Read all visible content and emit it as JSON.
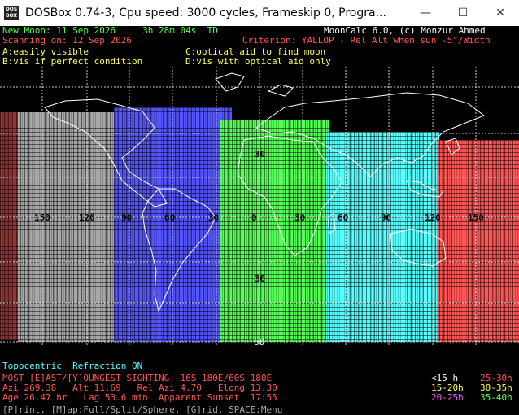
{
  "window": {
    "title": "DOSBox 0.74-3, Cpu speed:     3000 cycles, Frameskip  0, Progra...",
    "icon_label": "DOS BOX",
    "minimize": "—",
    "maximize": "☐",
    "close": "✕"
  },
  "header": {
    "new_moon": "New Moon: 11 Sep 2026     3h 28m 04s  TD",
    "program": "MoonCalc 6.0, (c) Monzur Ahmed",
    "scanning": "Scanning on: 12 Sep 2026",
    "criterion": "Criterion: YALLOP - Rel Alt when sun -5°/Width",
    "legend_a": "A:easily visible",
    "legend_c": "C:optical aid to find moon",
    "legend_b": "B:vis if perfect condition",
    "legend_d": "D:vis with optical aid only"
  },
  "map": {
    "lon_labels": [
      "150",
      "120",
      "90",
      "60",
      "30",
      "0",
      "30",
      "60",
      "90",
      "120",
      "150"
    ],
    "lat_labels": [
      "30",
      "30",
      "60"
    ],
    "zone_colors": {
      "d": "#a8a8a8",
      "c": "#5555ff",
      "b": "#55ff55",
      "a": "#55ffff",
      "none": "#ff5555"
    }
  },
  "info": {
    "topocentric": "Topocentric  Refraction ON",
    "most": "MOST [E]AST/[Y]OUNGEST SIGHTING: 16S 180E/60S 180E",
    "azi": "Azi 269.38   Alt 11.69   Rel Azi 4.70   Elong 13.30",
    "age": "Age 26.47 hr   Lag 53.6 min  Apparent Sunset  17:55",
    "lag_legend": {
      "lt15": "<15 h",
      "h15_20": "15-20h",
      "h20_25": "20-25h",
      "h25_30": "25-30h",
      "h30_35": "30-35h",
      "h35_40": "35-40h"
    }
  },
  "footer": {
    "menu": "[P]rint, [M]ap:Full/Split/Sphere, [G]rid, SPACE:Menu"
  },
  "colors": {
    "green": "#55ff55",
    "red": "#ff5555",
    "yellow": "#ffff55",
    "cyan": "#55ffff",
    "white": "#ffffff",
    "magenta": "#ff55ff",
    "grey": "#a8a8a8"
  }
}
